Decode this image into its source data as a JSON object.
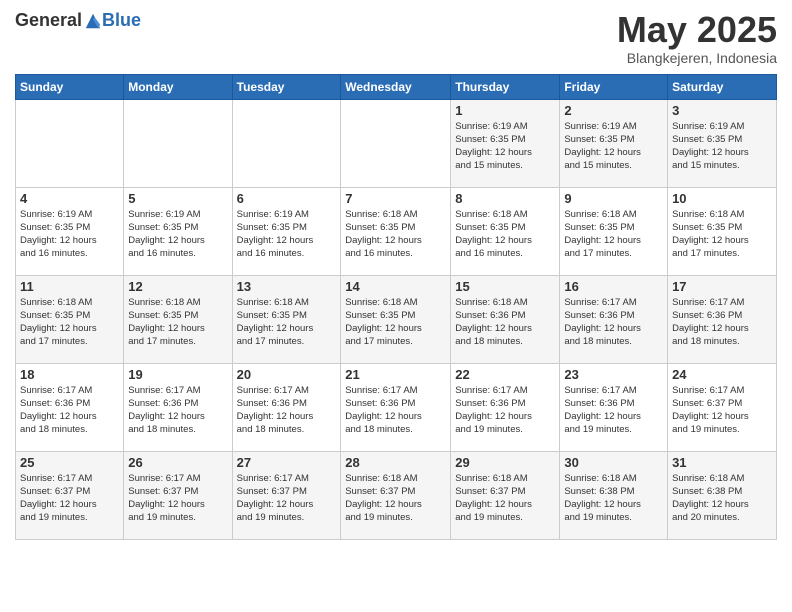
{
  "header": {
    "logo_general": "General",
    "logo_blue": "Blue",
    "month_title": "May 2025",
    "subtitle": "Blangkejeren, Indonesia"
  },
  "weekdays": [
    "Sunday",
    "Monday",
    "Tuesday",
    "Wednesday",
    "Thursday",
    "Friday",
    "Saturday"
  ],
  "weeks": [
    [
      {
        "day": "",
        "info": ""
      },
      {
        "day": "",
        "info": ""
      },
      {
        "day": "",
        "info": ""
      },
      {
        "day": "",
        "info": ""
      },
      {
        "day": "1",
        "info": "Sunrise: 6:19 AM\nSunset: 6:35 PM\nDaylight: 12 hours\nand 15 minutes."
      },
      {
        "day": "2",
        "info": "Sunrise: 6:19 AM\nSunset: 6:35 PM\nDaylight: 12 hours\nand 15 minutes."
      },
      {
        "day": "3",
        "info": "Sunrise: 6:19 AM\nSunset: 6:35 PM\nDaylight: 12 hours\nand 15 minutes."
      }
    ],
    [
      {
        "day": "4",
        "info": "Sunrise: 6:19 AM\nSunset: 6:35 PM\nDaylight: 12 hours\nand 16 minutes."
      },
      {
        "day": "5",
        "info": "Sunrise: 6:19 AM\nSunset: 6:35 PM\nDaylight: 12 hours\nand 16 minutes."
      },
      {
        "day": "6",
        "info": "Sunrise: 6:19 AM\nSunset: 6:35 PM\nDaylight: 12 hours\nand 16 minutes."
      },
      {
        "day": "7",
        "info": "Sunrise: 6:18 AM\nSunset: 6:35 PM\nDaylight: 12 hours\nand 16 minutes."
      },
      {
        "day": "8",
        "info": "Sunrise: 6:18 AM\nSunset: 6:35 PM\nDaylight: 12 hours\nand 16 minutes."
      },
      {
        "day": "9",
        "info": "Sunrise: 6:18 AM\nSunset: 6:35 PM\nDaylight: 12 hours\nand 17 minutes."
      },
      {
        "day": "10",
        "info": "Sunrise: 6:18 AM\nSunset: 6:35 PM\nDaylight: 12 hours\nand 17 minutes."
      }
    ],
    [
      {
        "day": "11",
        "info": "Sunrise: 6:18 AM\nSunset: 6:35 PM\nDaylight: 12 hours\nand 17 minutes."
      },
      {
        "day": "12",
        "info": "Sunrise: 6:18 AM\nSunset: 6:35 PM\nDaylight: 12 hours\nand 17 minutes."
      },
      {
        "day": "13",
        "info": "Sunrise: 6:18 AM\nSunset: 6:35 PM\nDaylight: 12 hours\nand 17 minutes."
      },
      {
        "day": "14",
        "info": "Sunrise: 6:18 AM\nSunset: 6:35 PM\nDaylight: 12 hours\nand 17 minutes."
      },
      {
        "day": "15",
        "info": "Sunrise: 6:18 AM\nSunset: 6:36 PM\nDaylight: 12 hours\nand 18 minutes."
      },
      {
        "day": "16",
        "info": "Sunrise: 6:17 AM\nSunset: 6:36 PM\nDaylight: 12 hours\nand 18 minutes."
      },
      {
        "day": "17",
        "info": "Sunrise: 6:17 AM\nSunset: 6:36 PM\nDaylight: 12 hours\nand 18 minutes."
      }
    ],
    [
      {
        "day": "18",
        "info": "Sunrise: 6:17 AM\nSunset: 6:36 PM\nDaylight: 12 hours\nand 18 minutes."
      },
      {
        "day": "19",
        "info": "Sunrise: 6:17 AM\nSunset: 6:36 PM\nDaylight: 12 hours\nand 18 minutes."
      },
      {
        "day": "20",
        "info": "Sunrise: 6:17 AM\nSunset: 6:36 PM\nDaylight: 12 hours\nand 18 minutes."
      },
      {
        "day": "21",
        "info": "Sunrise: 6:17 AM\nSunset: 6:36 PM\nDaylight: 12 hours\nand 18 minutes."
      },
      {
        "day": "22",
        "info": "Sunrise: 6:17 AM\nSunset: 6:36 PM\nDaylight: 12 hours\nand 19 minutes."
      },
      {
        "day": "23",
        "info": "Sunrise: 6:17 AM\nSunset: 6:36 PM\nDaylight: 12 hours\nand 19 minutes."
      },
      {
        "day": "24",
        "info": "Sunrise: 6:17 AM\nSunset: 6:37 PM\nDaylight: 12 hours\nand 19 minutes."
      }
    ],
    [
      {
        "day": "25",
        "info": "Sunrise: 6:17 AM\nSunset: 6:37 PM\nDaylight: 12 hours\nand 19 minutes."
      },
      {
        "day": "26",
        "info": "Sunrise: 6:17 AM\nSunset: 6:37 PM\nDaylight: 12 hours\nand 19 minutes."
      },
      {
        "day": "27",
        "info": "Sunrise: 6:17 AM\nSunset: 6:37 PM\nDaylight: 12 hours\nand 19 minutes."
      },
      {
        "day": "28",
        "info": "Sunrise: 6:18 AM\nSunset: 6:37 PM\nDaylight: 12 hours\nand 19 minutes."
      },
      {
        "day": "29",
        "info": "Sunrise: 6:18 AM\nSunset: 6:37 PM\nDaylight: 12 hours\nand 19 minutes."
      },
      {
        "day": "30",
        "info": "Sunrise: 6:18 AM\nSunset: 6:38 PM\nDaylight: 12 hours\nand 19 minutes."
      },
      {
        "day": "31",
        "info": "Sunrise: 6:18 AM\nSunset: 6:38 PM\nDaylight: 12 hours\nand 20 minutes."
      }
    ]
  ]
}
